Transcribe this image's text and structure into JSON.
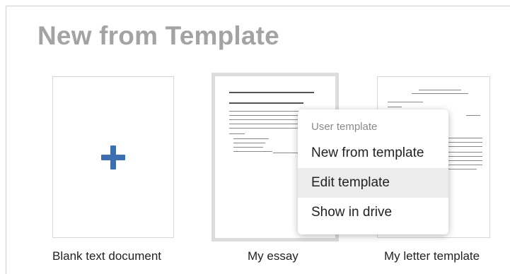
{
  "page": {
    "title": "New from Template"
  },
  "templates": [
    {
      "label": "Blank text document"
    },
    {
      "label": "My essay"
    },
    {
      "label": "My letter template"
    }
  ],
  "context_menu": {
    "header": "User template",
    "items": [
      {
        "label": "New from template"
      },
      {
        "label": "Edit template"
      },
      {
        "label": "Show in drive"
      }
    ],
    "highlighted_item": "Edit template"
  },
  "colors": {
    "accent": "#3b6fb0",
    "title": "#a3a3a3",
    "menu_highlight": "#ececec"
  },
  "icons": {
    "blank_template": "plus-icon"
  }
}
